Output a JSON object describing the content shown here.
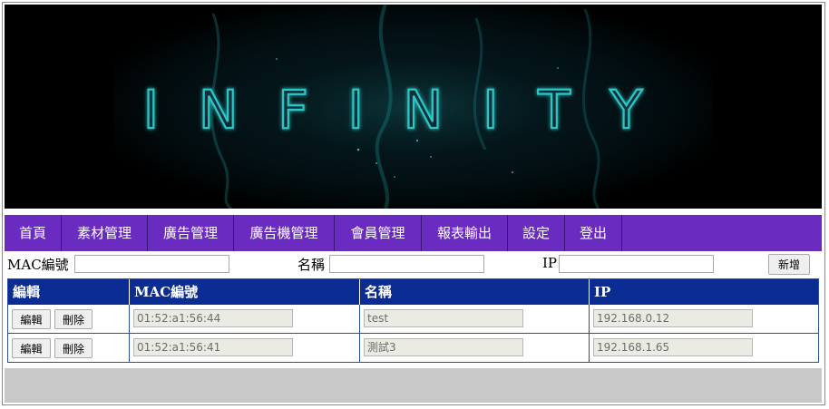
{
  "banner": {
    "logo_text": "INFINITY"
  },
  "nav": {
    "items": [
      {
        "label": "首頁"
      },
      {
        "label": "素材管理"
      },
      {
        "label": "廣告管理"
      },
      {
        "label": "廣告機管理"
      },
      {
        "label": "會員管理"
      },
      {
        "label": "報表輸出"
      },
      {
        "label": "設定"
      },
      {
        "label": "登出"
      }
    ]
  },
  "search": {
    "mac_label": "MAC編號",
    "mac_value": "",
    "name_label": "名稱",
    "name_value": "",
    "ip_label": "IP",
    "ip_value": "",
    "add_button": "新增"
  },
  "table": {
    "headers": [
      "編輯",
      "MAC編號",
      "名稱",
      "IP"
    ],
    "edit_label": "編輯",
    "delete_label": "刪除",
    "rows": [
      {
        "mac": "01:52:a1:56:44",
        "name": "test",
        "ip": "192.168.0.12"
      },
      {
        "mac": "01:52:a1:56:41",
        "name": "測試3",
        "ip": "192.168.1.65"
      }
    ]
  },
  "colors": {
    "nav_bg": "#6a2bc1",
    "table_header_bg": "#0b2d93",
    "footer_bg": "#c8c8c8",
    "logo_glow": "#1fb3b3"
  }
}
